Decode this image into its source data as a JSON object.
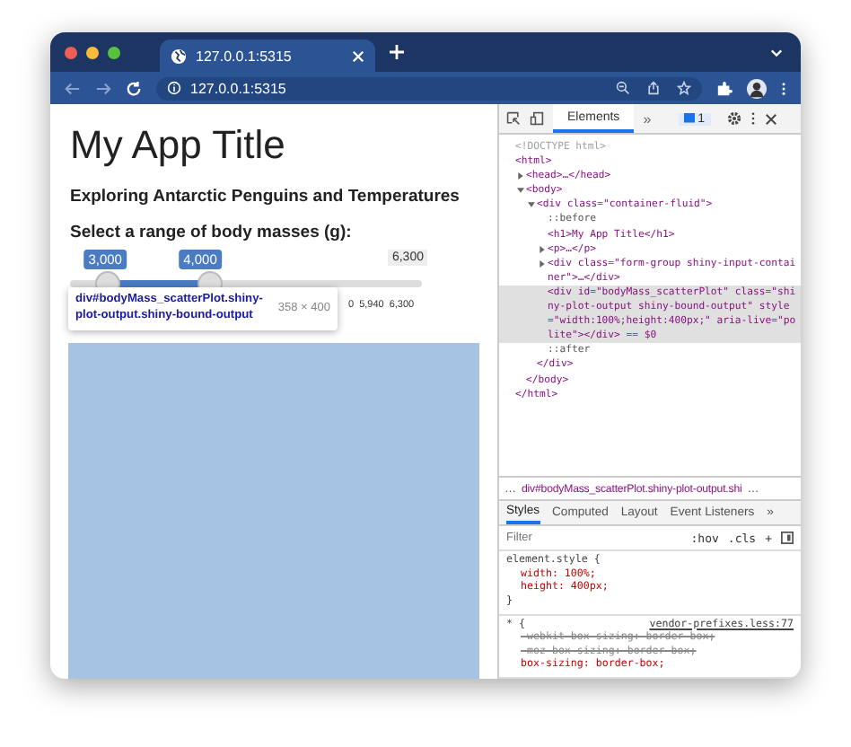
{
  "browser": {
    "tab": {
      "title": "127.0.0.1:5315",
      "selected": true
    },
    "url": "127.0.0.1:5315"
  },
  "page": {
    "title": "My App Title",
    "subtitle": "Exploring Antarctic Penguins and Temperatures",
    "slider": {
      "label": "Select a range of body masses (g):",
      "max_label": "6,300",
      "handles": [
        {
          "label": "3,000",
          "level": 0.1
        },
        {
          "label": "4,000",
          "level": 0.37
        }
      ],
      "tick_labels": [
        "0",
        "5,940",
        "6,300"
      ]
    },
    "plot": {
      "highlighted": true
    }
  },
  "inspect_tooltip": {
    "selector": "div#bodyMass_scatterPlot.shiny-plot-output.shiny-bound-output",
    "size": "358 × 400"
  },
  "devtools": {
    "tabs": [
      {
        "label": "Elements",
        "selected": true
      }
    ],
    "more": "»",
    "issues_count": "1",
    "dom": [
      {
        "text": "<!DOCTYPE html>",
        "kind": "doctype"
      },
      {
        "text": "<html>",
        "kind": "tag",
        "close": "</html>",
        "children": [
          {
            "text": "<head>…</head>",
            "kind": "tag",
            "expanded": false
          },
          {
            "text": "<body>",
            "kind": "tag",
            "expanded": true,
            "close": "</body>",
            "children": [
              {
                "text": "<div class=\"container-fluid\">",
                "kind": "tag",
                "expanded": true,
                "close": "</div>",
                "children": [
                  {
                    "text": "::before",
                    "kind": "pseudo"
                  },
                  {
                    "text": "<h1>My App Title</h1>",
                    "kind": "tag"
                  },
                  {
                    "text": "<p>…</p>",
                    "kind": "tag",
                    "expanded": false
                  },
                  {
                    "text": "<div class=\"form-group shiny-input-container\">…</div>",
                    "kind": "tag",
                    "expanded": false
                  },
                  {
                    "text": "<div id=\"bodyMass_scatterPlot\" class=\"shiny-plot-output shiny-bound-output\" style=\"width:100%;height:400px;\" aria-live=\"polite\"></div> == $0",
                    "kind": "tag",
                    "selected": true
                  },
                  {
                    "text": "::after",
                    "kind": "pseudo"
                  }
                ]
              }
            ]
          }
        ]
      }
    ],
    "breadcrumb_before": "…",
    "breadcrumb": "div#bodyMass_scatterPlot.shiny-plot-output.shi",
    "breadcrumb_after": "…",
    "style_tabs": [
      {
        "label": "Styles",
        "selected": true
      },
      {
        "label": "Computed",
        "selected": false
      },
      {
        "label": "Layout",
        "selected": false
      },
      {
        "label": "Event Listeners",
        "selected": false
      }
    ],
    "style_tabs_more": "»",
    "filter_placeholder": "Filter",
    "hov": ":hov",
    "cls": ".cls",
    "plus": "+",
    "rules": [
      {
        "selector": "element.style {",
        "props": [
          {
            "text": "width: 100%;",
            "struck": false
          },
          {
            "text": "height: 400px;",
            "struck": false
          }
        ],
        "close": "}"
      },
      {
        "selector": "* {",
        "source": "vendor-prefixes.less:77",
        "props": [
          {
            "text": "-webkit-box-sizing: border-box;",
            "struck": true
          },
          {
            "text": "-moz-box-sizing: border-box;",
            "struck": true
          },
          {
            "text": "box-sizing: border-box;",
            "struck": false
          }
        ]
      }
    ]
  }
}
